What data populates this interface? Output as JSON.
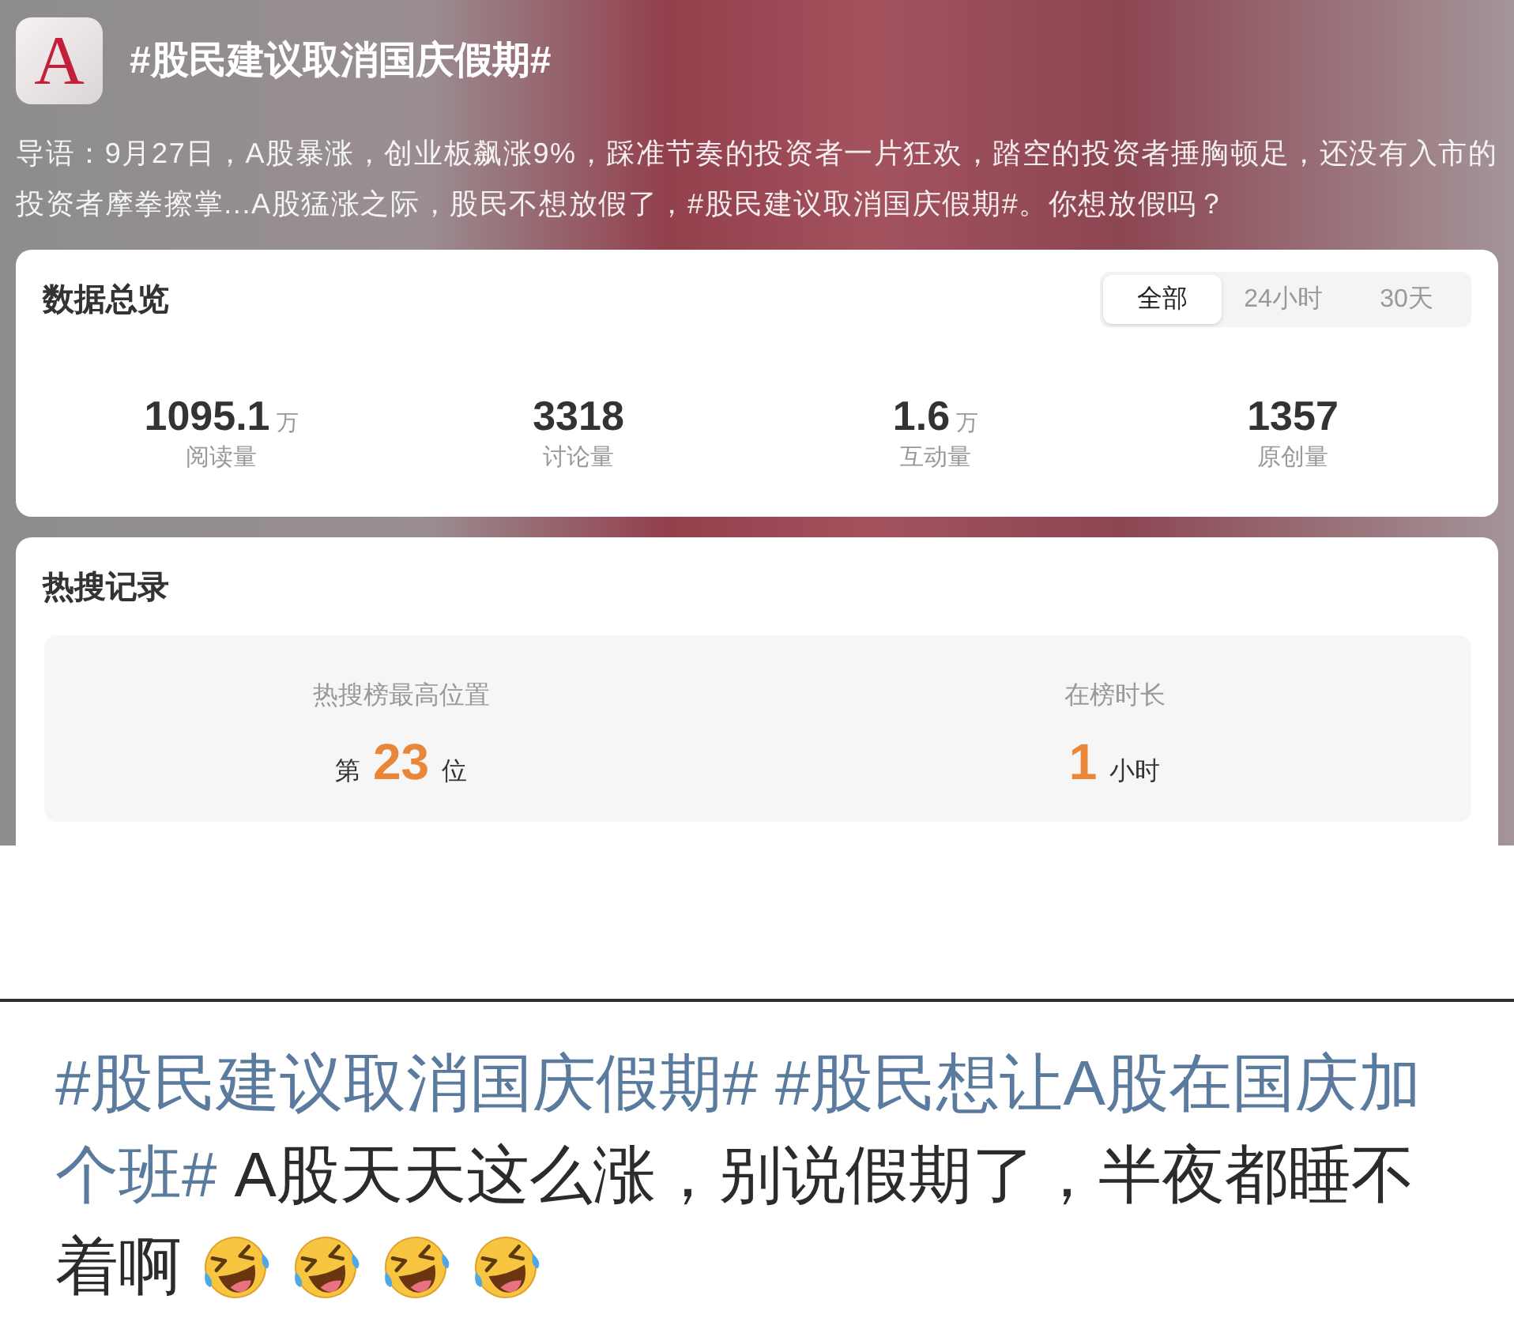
{
  "header": {
    "logo": "A",
    "title": "#股民建议取消国庆假期#"
  },
  "intro": "导语：9月27日，A股暴涨，创业板飙涨9%，踩准节奏的投资者一片狂欢，踏空的投资者捶胸顿足，还没有入市的投资者摩拳擦掌...A股猛涨之际，股民不想放假了，#股民建议取消国庆假期#。你想放假吗？",
  "overview": {
    "title": "数据总览",
    "tabs": [
      {
        "label": "全部",
        "selected": true
      },
      {
        "label": "24小时",
        "selected": false
      },
      {
        "label": "30天",
        "selected": false
      }
    ],
    "stats": [
      {
        "value": "1095.1",
        "unit": "万",
        "label": "阅读量"
      },
      {
        "value": "3318",
        "label": "讨论量"
      },
      {
        "value": "1.6",
        "unit": "万",
        "label": "互动量"
      },
      {
        "value": "1357",
        "label": "原创量"
      }
    ]
  },
  "hot_search": {
    "title": "热搜记录",
    "records": [
      {
        "label": "热搜榜最高位置",
        "prefix": "第",
        "value": "23",
        "suffix": "位"
      },
      {
        "label": "在榜时长",
        "value": "1",
        "suffix": "小时"
      }
    ]
  },
  "post": {
    "lines": [
      [
        {
          "kind": "hashtag",
          "text": "#股民建议取消国庆假期#"
        },
        {
          "kind": "hashtag",
          "text": "#股民想让A股在国庆加"
        }
      ],
      [
        {
          "kind": "hashtag",
          "text": "个班#"
        },
        {
          "kind": "text",
          "text": "A股天天这么涨，别说假期了，半夜都睡不"
        }
      ],
      [
        {
          "kind": "text",
          "text": "着啊"
        },
        {
          "kind": "emoji"
        },
        {
          "kind": "emoji"
        },
        {
          "kind": "emoji"
        },
        {
          "kind": "emoji"
        }
      ]
    ]
  }
}
